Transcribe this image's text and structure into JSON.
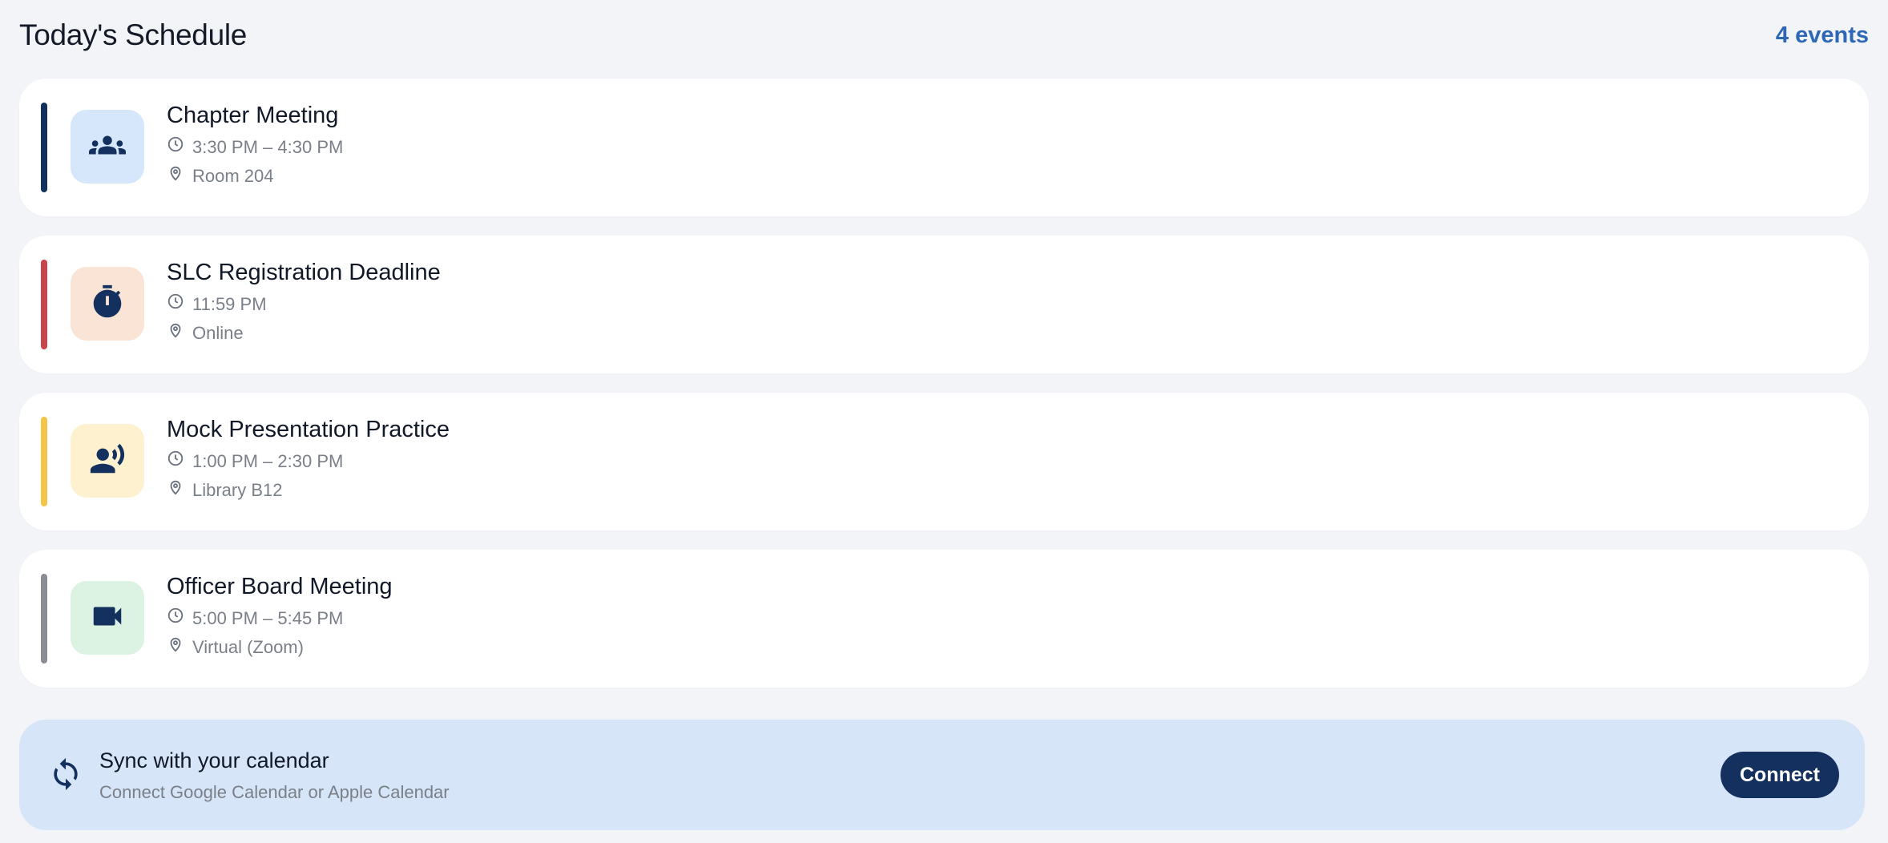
{
  "header": {
    "title": "Today's Schedule",
    "count": "4 events"
  },
  "events": [
    {
      "title": "Chapter Meeting",
      "time": "3:30 PM – 4:30 PM",
      "location": "Room 204",
      "icon": "group-icon",
      "accent_color": "#14305e",
      "tile_color": "#d7e7fb"
    },
    {
      "title": "SLC Registration Deadline",
      "time": "11:59 PM",
      "location": "Online",
      "icon": "timer-icon",
      "accent_color": "#c9444b",
      "tile_color": "#f9e4d6"
    },
    {
      "title": "Mock Presentation Practice",
      "time": "1:00 PM – 2:30 PM",
      "location": "Library B12",
      "icon": "speaker-person-icon",
      "accent_color": "#f3c649",
      "tile_color": "#fdf1cf"
    },
    {
      "title": "Officer Board Meeting",
      "time": "5:00 PM – 5:45 PM",
      "location": "Virtual (Zoom)",
      "icon": "video-camera-icon",
      "accent_color": "#8a8d93",
      "tile_color": "#dcf3e3"
    }
  ],
  "sync": {
    "title": "Sync with your calendar",
    "subtitle": "Connect Google Calendar or Apple Calendar",
    "button_label": "Connect",
    "icon": "sync-icon"
  }
}
